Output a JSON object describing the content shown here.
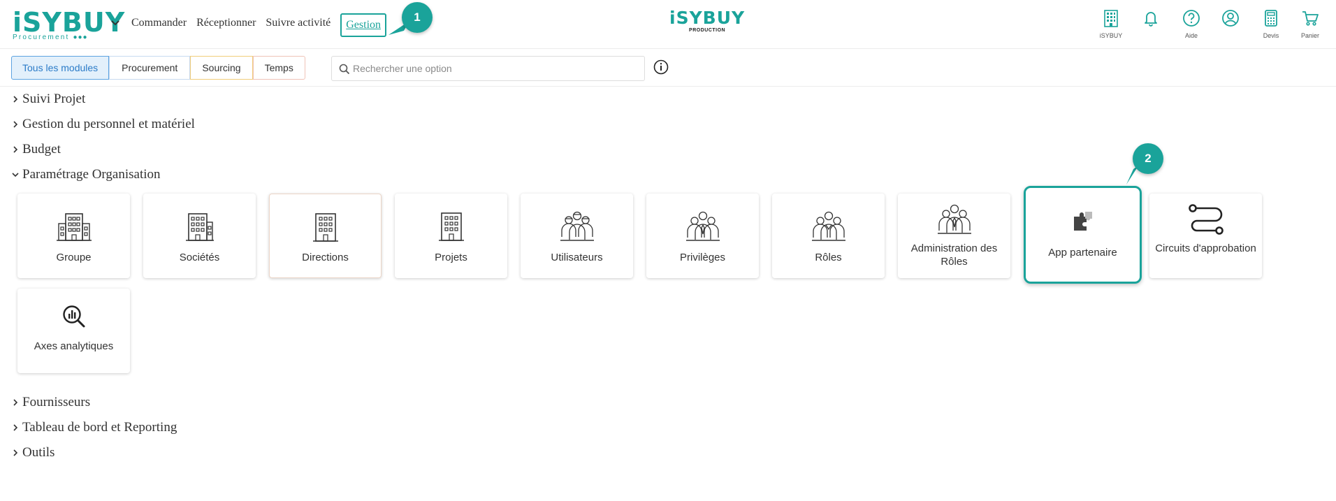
{
  "header": {
    "logo": {
      "main": "iSYBUY",
      "sub": "Procurement"
    },
    "nav": [
      "Commander",
      "Réceptionner",
      "Suivre activité",
      "Gestion"
    ],
    "center_logo": {
      "main": "iSYBUY",
      "sub": "PRODUCTION"
    },
    "icons": [
      {
        "name": "isybuy-building-icon",
        "label": "iSYBUY"
      },
      {
        "name": "bell-icon",
        "label": ""
      },
      {
        "name": "help-icon",
        "label": "Aide"
      },
      {
        "name": "account-icon",
        "label": ""
      },
      {
        "name": "calculator-icon",
        "label": "Devis"
      },
      {
        "name": "cart-icon",
        "label": "Panier"
      }
    ]
  },
  "annotations": {
    "step1": "1",
    "step2": "2"
  },
  "filters": [
    "Tous les modules",
    "Procurement",
    "Sourcing",
    "Temps"
  ],
  "search": {
    "placeholder": "Rechercher une option",
    "value": ""
  },
  "sections": {
    "suivi_projet": "Suivi Projet",
    "gestion_personnel": "Gestion du personnel et matériel",
    "budget": "Budget",
    "parametrage": "Paramétrage Organisation",
    "fournisseurs": "Fournisseurs",
    "tableau_bord": "Tableau de bord et Reporting",
    "outils": "Outils"
  },
  "cards": [
    {
      "label": "Groupe",
      "icon": "building-icon"
    },
    {
      "label": "Sociétés",
      "icon": "building-icon"
    },
    {
      "label": "Directions",
      "icon": "building-icon"
    },
    {
      "label": "Projets",
      "icon": "building-icon"
    },
    {
      "label": "Utilisateurs",
      "icon": "users-group-icon"
    },
    {
      "label": "Privilèges",
      "icon": "users-group-icon"
    },
    {
      "label": "Rôles",
      "icon": "users-group-icon"
    },
    {
      "label": "Administration des Rôles",
      "icon": "users-group-icon"
    },
    {
      "label": "App partenaire",
      "icon": "puzzle-icon"
    },
    {
      "label": "Circuits d'approbation",
      "icon": "workflow-icon"
    },
    {
      "label": "Axes analytiques",
      "icon": "analytics-search-icon"
    }
  ],
  "colors": {
    "brand": "#1aa39a",
    "active_filter": "#2b7bc8"
  }
}
